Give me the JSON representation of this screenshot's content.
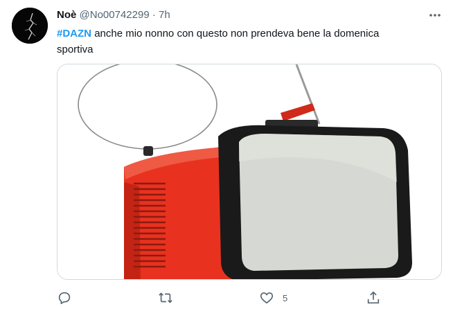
{
  "tweet": {
    "author_name": "Noè",
    "handle": "@No00742299",
    "separator": "·",
    "time": "7h",
    "hashtag": "#DAZN",
    "text_rest": "anche mio nonno con questo non prendeva bene la domenica",
    "text_line2": "sportiva"
  },
  "actions": {
    "reply_icon": "reply-icon",
    "retweet_icon": "retweet-icon",
    "like_icon": "heart-icon",
    "like_count": "5",
    "share_icon": "share-icon"
  },
  "colors": {
    "hashtag": "#1d9bf0",
    "muted": "#536471",
    "tv_red": "#e8321f"
  }
}
